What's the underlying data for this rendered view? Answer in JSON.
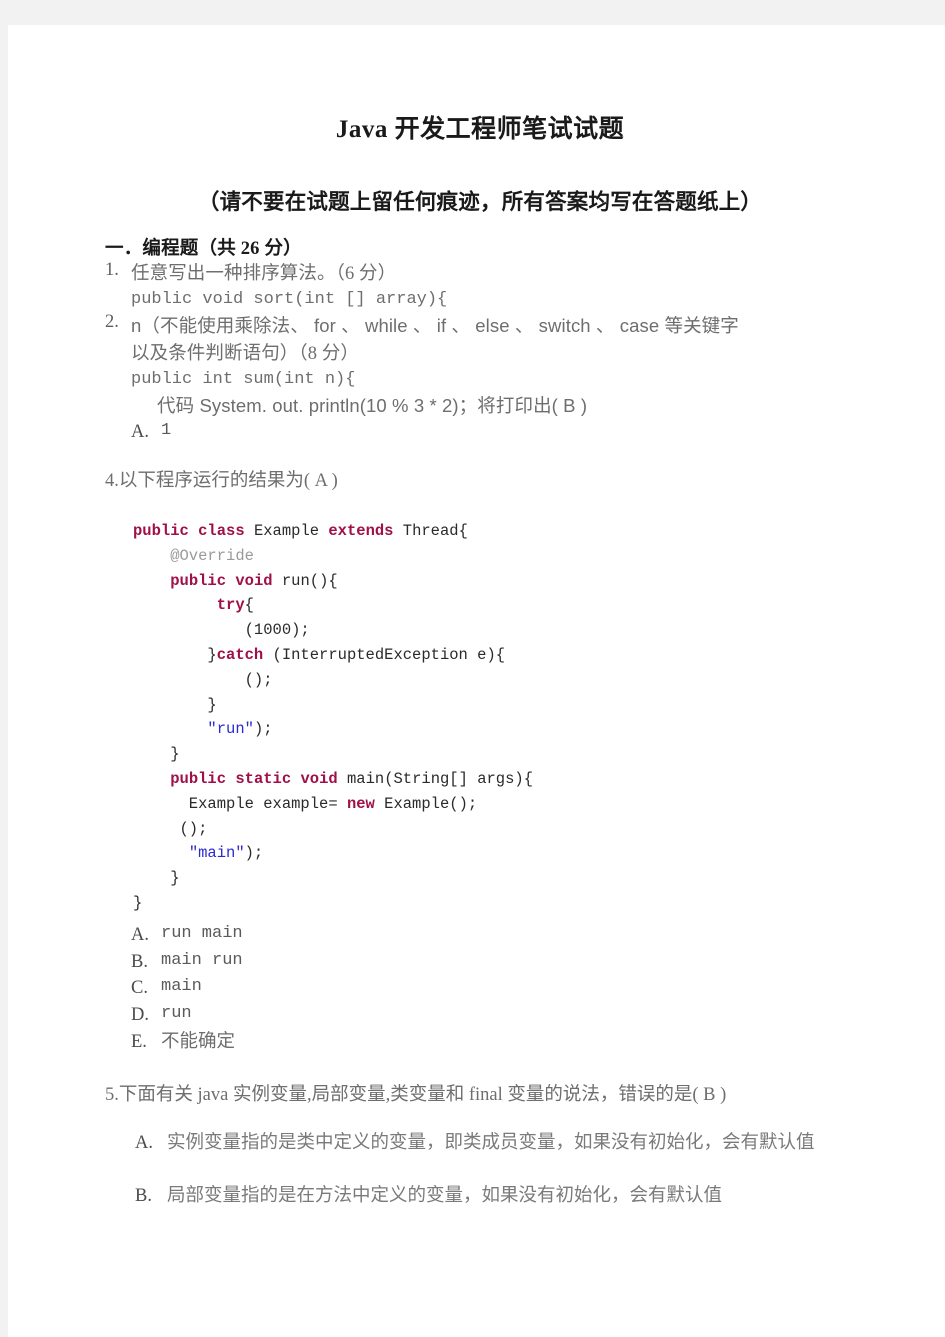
{
  "document": {
    "title": "Java 开发工程师笔试试题",
    "subtitle": "（请不要在试题上留任何痕迹，所有答案均写在答题纸上）"
  },
  "section": {
    "heading": "一．编程题（共 26 分）"
  },
  "questions": {
    "q1": {
      "number": "1.",
      "text": "任意写出一种排序算法。（6 分）",
      "code": "public void sort(int [] array){"
    },
    "q2": {
      "number": "2.",
      "text": "n（不能使用乘除法、 for 、 while 、 if 、 else 、 switch 、 case 等关键字",
      "text_line2": "以及条件判断语句）（8 分）",
      "code": "public int sum(int n){",
      "inner_text": "代码 System. out. println(10 % 3 * 2)；将打印出( B )",
      "option_a": "A.",
      "option_a_text": "1"
    },
    "q4": {
      "number": "4.",
      "text": "以下程序运行的结果为(    A    )",
      "options": [
        {
          "label": "A.",
          "text": "run main"
        },
        {
          "label": "B.",
          "text": "main run"
        },
        {
          "label": "C.",
          "text": "main"
        },
        {
          "label": "D.",
          "text": "run"
        },
        {
          "label": "E.",
          "text": "不能确定"
        }
      ]
    },
    "q5": {
      "number": "5.",
      "text": "下面有关 java 实例变量,局部变量,类变量和 final 变量的说法，错误的是(    B    )",
      "options": [
        {
          "label": "A.",
          "text": "实例变量指的是类中定义的变量，即类成员变量，如果没有初始化，会有默认值"
        },
        {
          "label": "B.",
          "text": "局部变量指的是在方法中定义的变量，如果没有初始化，会有默认值"
        }
      ]
    }
  },
  "code_sample": {
    "lines": [
      [
        {
          "t": "public ",
          "c": "kw"
        },
        {
          "t": "class ",
          "c": "kw"
        },
        {
          "t": "Example ",
          "c": "plain"
        },
        {
          "t": "extends ",
          "c": "kw"
        },
        {
          "t": "Thread{",
          "c": "plain"
        }
      ],
      [
        {
          "t": "    @Override",
          "c": "ann"
        }
      ],
      [
        {
          "t": "    ",
          "c": "plain"
        },
        {
          "t": "public ",
          "c": "kw"
        },
        {
          "t": "void ",
          "c": "kw"
        },
        {
          "t": "run(){",
          "c": "plain"
        }
      ],
      [
        {
          "t": "         ",
          "c": "plain"
        },
        {
          "t": "try",
          "c": "kw"
        },
        {
          "t": "{",
          "c": "plain"
        }
      ],
      [
        {
          "t": "            (1000);",
          "c": "plain"
        }
      ],
      [
        {
          "t": "        }",
          "c": "plain"
        },
        {
          "t": "catch ",
          "c": "kw"
        },
        {
          "t": "(InterruptedException e){",
          "c": "plain"
        }
      ],
      [
        {
          "t": "            ();",
          "c": "plain"
        }
      ],
      [
        {
          "t": "        }",
          "c": "plain"
        }
      ],
      [
        {
          "t": "        ",
          "c": "plain"
        },
        {
          "t": "\"run\"",
          "c": "str"
        },
        {
          "t": ");",
          "c": "plain"
        }
      ],
      [
        {
          "t": "    }",
          "c": "plain"
        }
      ],
      [
        {
          "t": "    ",
          "c": "plain"
        },
        {
          "t": "public ",
          "c": "kw"
        },
        {
          "t": "static ",
          "c": "kw"
        },
        {
          "t": "void ",
          "c": "kw"
        },
        {
          "t": "main(String[] args){",
          "c": "plain"
        }
      ],
      [
        {
          "t": "      Example example= ",
          "c": "plain"
        },
        {
          "t": "new ",
          "c": "kw"
        },
        {
          "t": "Example();",
          "c": "plain"
        }
      ],
      [
        {
          "t": "     ();",
          "c": "plain"
        }
      ],
      [
        {
          "t": "      ",
          "c": "plain"
        },
        {
          "t": "\"main\"",
          "c": "str"
        },
        {
          "t": ");",
          "c": "plain"
        }
      ],
      [
        {
          "t": "    }",
          "c": "plain"
        }
      ],
      [
        {
          "t": "}",
          "c": "plain"
        }
      ]
    ]
  }
}
